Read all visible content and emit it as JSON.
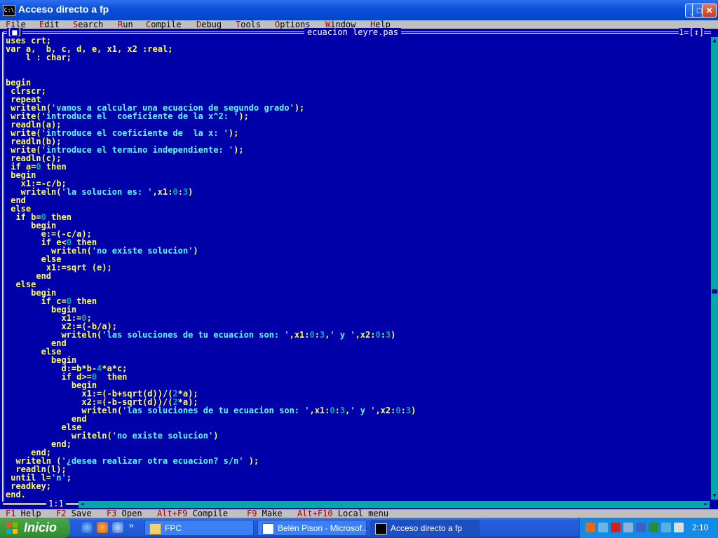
{
  "window": {
    "title": "Acceso directo a fp",
    "minimize": "_",
    "maximize": "□",
    "close": "✕"
  },
  "menu": [
    {
      "hot": "F",
      "rest": "ile"
    },
    {
      "hot": "E",
      "rest": "dit"
    },
    {
      "hot": "S",
      "rest": "earch"
    },
    {
      "hot": "R",
      "rest": "un"
    },
    {
      "hot": "C",
      "rest": "ompile"
    },
    {
      "hot": "D",
      "rest": "ebug"
    },
    {
      "hot": "T",
      "rest": "ools"
    },
    {
      "hot": "O",
      "rest": "ptions"
    },
    {
      "hot": "W",
      "rest": "indow"
    },
    {
      "hot": "H",
      "rest": "elp"
    }
  ],
  "editor": {
    "filename": "ecuacion leyre.pas",
    "close_button": "[■]",
    "window_number": "1",
    "zoom_button": "[↕]",
    "cursor_position": "1:1"
  },
  "code": [
    "uses crt;",
    "var a,  b, c, d, e, x1, x2 :real;",
    "    l : char;",
    "",
    "",
    "begin",
    " clrscr;",
    " repeat",
    " writeln('vamos a calcular una ecuacion de segundo grado');",
    " write('introduce el  coeficiente de la x^2: ');",
    " readln(a);",
    " write('introduce el coeficiente de  la x: ');",
    " readln(b);",
    " write('introduce el termino independiente: ');",
    " readln(c);",
    " if a=0 then",
    " begin",
    "   x1:=-c/b;",
    "   writeln('la solucion es: ',x1:0:3)",
    " end",
    " else",
    "  if b=0 then",
    "     begin",
    "       e:=(-c/a);",
    "       if e<0 then",
    "         writeln('no existe solucion')",
    "       else",
    "        x1:=sqrt (e);",
    "      end",
    "  else",
    "     begin",
    "       if c=0 then",
    "         begin",
    "           x1:=0;",
    "           x2:=(-b/a);",
    "           writeln('las soluciones de tu ecuacion son: ',x1:0:3,' y ',x2:0:3)",
    "         end",
    "       else",
    "         begin",
    "           d:=b*b-4*a*c;",
    "           if d>=0  then",
    "             begin",
    "               x1:=(-b+sqrt(d))/(2*a);",
    "               x2:=(-b-sqrt(d))/(2*a);",
    "               writeln('las soluciones de tu ecuacion son: ',x1:0:3,' y ',x2:0:3)",
    "             end",
    "           else",
    "             writeln('no existe solucion')",
    "         end;",
    "     end;",
    "  writeln ('¿desea realizar otra ecuacion? s/n' );",
    "  readln(l);",
    " until l='n';",
    " readkey;",
    "end."
  ],
  "status_bar": [
    {
      "key": "F1",
      "label": " Help"
    },
    {
      "key": "F2",
      "label": " Save"
    },
    {
      "key": "F3",
      "label": " Open"
    },
    {
      "key": "Alt+F9",
      "label": " Compile"
    },
    {
      "key": "F9",
      "label": " Make"
    },
    {
      "key": "Alt+F10",
      "label": " Local menu"
    }
  ],
  "taskbar": {
    "start_label": "Inicio",
    "quicklaunch_more": "»",
    "tasks": [
      {
        "label": "FPC",
        "icon": "folder-icon",
        "active": false
      },
      {
        "label": "Belén Pison - Microsof...",
        "icon": "word-icon",
        "active": false
      },
      {
        "label": "Acceso directo a fp",
        "icon": "console-icon",
        "active": true
      }
    ],
    "clock": "2:10"
  },
  "colors": {
    "editor_bg": "#0000a8",
    "code_text": "#ffff55",
    "string_text": "#55ffff",
    "number_text": "#00aaaa",
    "menu_bg": "#c0c0c0",
    "hotkey": "#a80000"
  }
}
